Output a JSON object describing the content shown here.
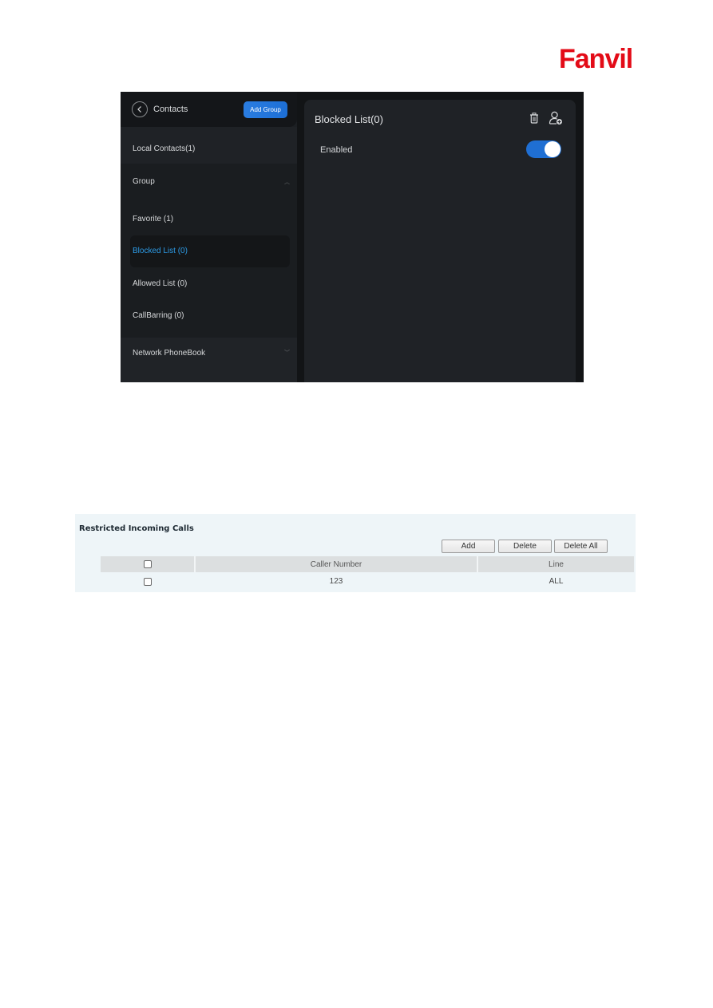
{
  "logo": {
    "text": "Fanvil",
    "color": "#e30b17"
  },
  "phone_ui": {
    "header": {
      "title": "Contacts",
      "add_group_label": "Add Group"
    },
    "sidebar": {
      "local_contacts": "Local Contacts(1)",
      "group": {
        "label": "Group",
        "expanded": true
      },
      "group_items": [
        {
          "label": "Favorite  (1)",
          "active": false
        },
        {
          "label": "Blocked List  (0)",
          "active": true
        },
        {
          "label": "Allowed List  (0)",
          "active": false
        },
        {
          "label": "CallBarring  (0)",
          "active": false
        }
      ],
      "network_phonebook": {
        "label": "Network PhoneBook",
        "expanded": false
      }
    },
    "main": {
      "title": "Blocked List(0)",
      "enabled_label": "Enabled",
      "enabled": true
    },
    "colors": {
      "accent": "#1f6fd3",
      "active_text": "#2d9be6"
    }
  },
  "web_ui": {
    "title": "Restricted Incoming Calls",
    "buttons": {
      "add": "Add",
      "delete": "Delete",
      "delete_all": "Delete All"
    },
    "columns": [
      "",
      "Caller Number",
      "Line"
    ],
    "rows": [
      {
        "checked": false,
        "caller_number": "123",
        "line": "ALL"
      }
    ]
  }
}
